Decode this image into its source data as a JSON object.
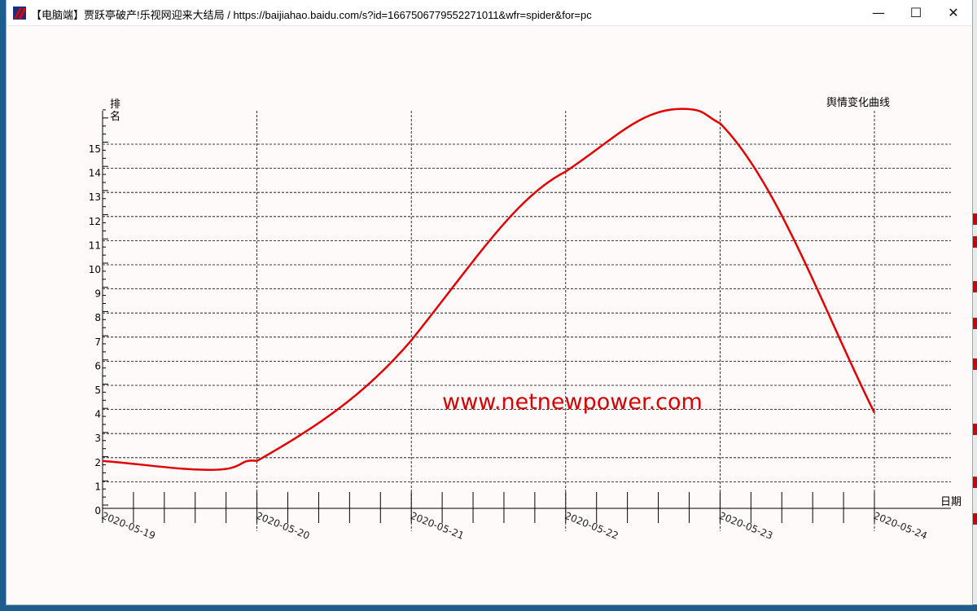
{
  "window": {
    "title": "【电脑端】贾跃亭破产!乐视网迎来大结局 / https://baijiahao.baidu.com/s?id=1667506779552271011&wfr=spider&for=pc",
    "minimize_glyph": "—",
    "maximize_glyph": "☐",
    "close_glyph": "✕"
  },
  "watermark": "www.netnewpower.com",
  "colors": {
    "line": "#e00000",
    "watermark": "#d40000",
    "grid": "#000000",
    "background": "#fdfaf9"
  },
  "chart_data": {
    "type": "line",
    "title": "舆情变化曲线",
    "xlabel": "日期",
    "ylabel": "排名",
    "categories": [
      "2020-05-19",
      "2020-05-20",
      "2020-05-21",
      "2020-05-22",
      "2020-05-23",
      "2020-05-24"
    ],
    "y_ticks": [
      "0",
      "1",
      "2",
      "3",
      "4",
      "5",
      "6",
      "7",
      "8",
      "9",
      "10",
      "11",
      "12",
      "13",
      "14",
      "15"
    ],
    "ylim": [
      0,
      16
    ],
    "grid": true,
    "series": [
      {
        "values": [
          2.0,
          2.0,
          7.0,
          14.0,
          16.0,
          4.0
        ],
        "min_point": {
          "x": 0.7,
          "y": 1.63
        },
        "peak_point": {
          "x": 3.75,
          "y": 16.6
        }
      }
    ]
  }
}
